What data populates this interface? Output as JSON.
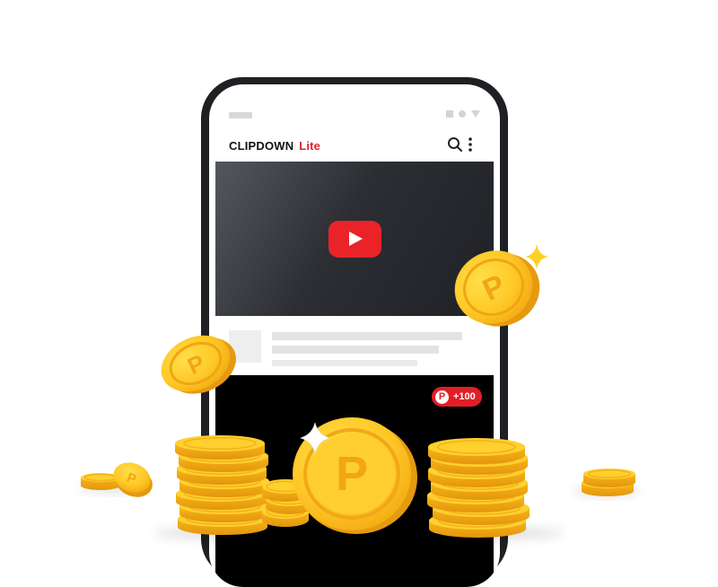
{
  "app": {
    "brand_main": "CLIPDOWN",
    "brand_accent": "Lite"
  },
  "reward_badge": {
    "icon_letter": "P",
    "amount": "+100"
  },
  "coin_letter": "P",
  "icons": {
    "search": "search-icon",
    "more": "more-vertical-icon",
    "play": "youtube-play-icon",
    "sparkle": "sparkle-icon"
  },
  "colors": {
    "accent_red": "#e21e26",
    "coin_gold": "#ffc928",
    "phone_frame": "#1f2024"
  }
}
